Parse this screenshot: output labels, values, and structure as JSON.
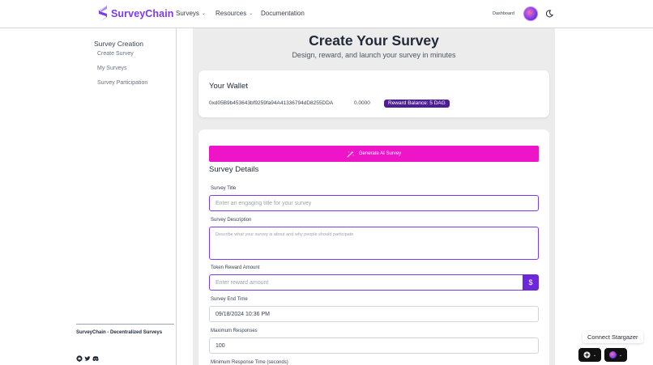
{
  "header": {
    "brand": "SurveyChain",
    "nav": [
      {
        "label": "Surveys",
        "chevron": "⌄"
      },
      {
        "label": "Resources",
        "chevron": "⌄"
      },
      {
        "label": "Documentation",
        "chevron": ""
      }
    ],
    "dashboard_label": "Dashboard",
    "icons": {
      "logo": "s-logo-icon",
      "avatar": "avatar",
      "theme": "moon-icon"
    }
  },
  "sidebar": {
    "heading": "Survey Creation",
    "items": [
      {
        "label": "Create Survey"
      },
      {
        "label": "My Surveys"
      },
      {
        "label": "Survey Participation"
      }
    ],
    "footer_brand": "SurveyChain - Decentralized Surveys",
    "social_icons": [
      "github-icon",
      "twitter-icon",
      "discord-icon"
    ]
  },
  "main": {
    "title": "Create Your Survey",
    "subtitle": "Design, reward, and launch your survey in minutes",
    "wallet": {
      "title": "Your Wallet",
      "address": "0xd05B9b453643bf9259fa94A41336794dD8255DDA",
      "balance": "0.0000",
      "reward_badge": "Reward Balance: 5 DAG"
    },
    "form": {
      "ai_button_label": "Generate AI Survey",
      "section_title": "Survey Details",
      "fields": {
        "title_label": "Survey Title",
        "title_placeholder": "Enter an engaging title for your survey",
        "description_label": "Survey Description",
        "description_placeholder": "Describe what your survey is about and why people should participate",
        "reward_label": "Token Reward Amount",
        "reward_placeholder": "Enter reward amount",
        "reward_button": "$",
        "end_time_label": "Survey End Time",
        "end_time_value": "09/18/2024  10:36  PM",
        "max_responses_label": "Maximum Responses",
        "max_responses_value": "100",
        "min_time_label": "Minimum Response Time (seconds)"
      }
    }
  },
  "wallet_widget": {
    "connect_label": "Connect Stargazer",
    "chevron": "⌄"
  },
  "colors": {
    "brand": "#7c3aed",
    "ai_button": "#ee14c8",
    "badge": "#4c1d95",
    "main_bg": "#ececec"
  }
}
